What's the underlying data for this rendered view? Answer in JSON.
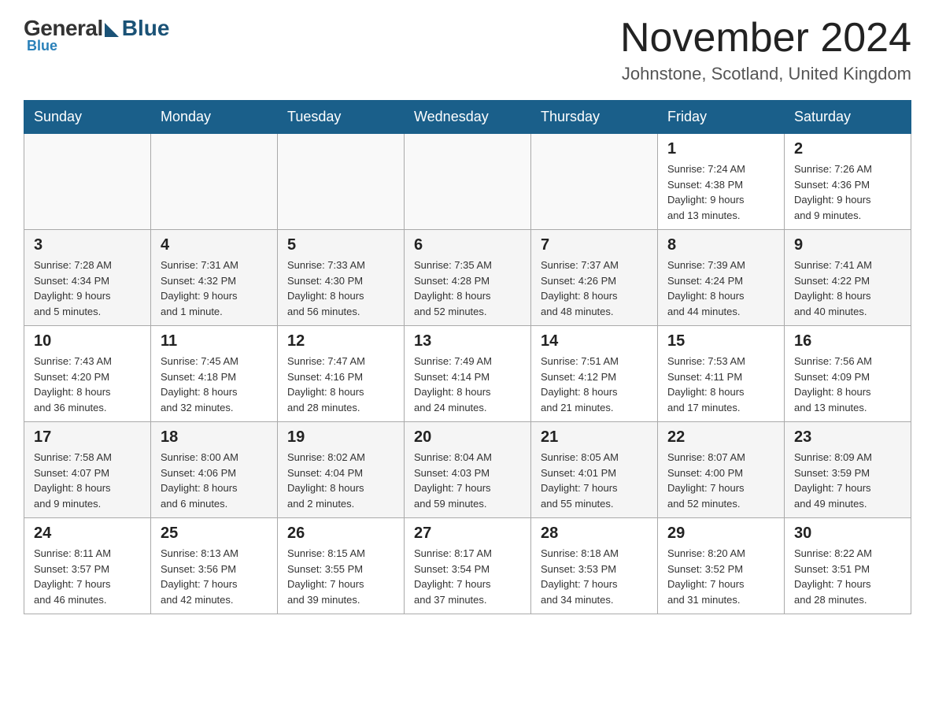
{
  "header": {
    "logo_general": "General",
    "logo_blue": "Blue",
    "month_title": "November 2024",
    "location": "Johnstone, Scotland, United Kingdom"
  },
  "weekdays": [
    "Sunday",
    "Monday",
    "Tuesday",
    "Wednesday",
    "Thursday",
    "Friday",
    "Saturday"
  ],
  "weeks": [
    [
      {
        "day": "",
        "info": ""
      },
      {
        "day": "",
        "info": ""
      },
      {
        "day": "",
        "info": ""
      },
      {
        "day": "",
        "info": ""
      },
      {
        "day": "",
        "info": ""
      },
      {
        "day": "1",
        "info": "Sunrise: 7:24 AM\nSunset: 4:38 PM\nDaylight: 9 hours\nand 13 minutes."
      },
      {
        "day": "2",
        "info": "Sunrise: 7:26 AM\nSunset: 4:36 PM\nDaylight: 9 hours\nand 9 minutes."
      }
    ],
    [
      {
        "day": "3",
        "info": "Sunrise: 7:28 AM\nSunset: 4:34 PM\nDaylight: 9 hours\nand 5 minutes."
      },
      {
        "day": "4",
        "info": "Sunrise: 7:31 AM\nSunset: 4:32 PM\nDaylight: 9 hours\nand 1 minute."
      },
      {
        "day": "5",
        "info": "Sunrise: 7:33 AM\nSunset: 4:30 PM\nDaylight: 8 hours\nand 56 minutes."
      },
      {
        "day": "6",
        "info": "Sunrise: 7:35 AM\nSunset: 4:28 PM\nDaylight: 8 hours\nand 52 minutes."
      },
      {
        "day": "7",
        "info": "Sunrise: 7:37 AM\nSunset: 4:26 PM\nDaylight: 8 hours\nand 48 minutes."
      },
      {
        "day": "8",
        "info": "Sunrise: 7:39 AM\nSunset: 4:24 PM\nDaylight: 8 hours\nand 44 minutes."
      },
      {
        "day": "9",
        "info": "Sunrise: 7:41 AM\nSunset: 4:22 PM\nDaylight: 8 hours\nand 40 minutes."
      }
    ],
    [
      {
        "day": "10",
        "info": "Sunrise: 7:43 AM\nSunset: 4:20 PM\nDaylight: 8 hours\nand 36 minutes."
      },
      {
        "day": "11",
        "info": "Sunrise: 7:45 AM\nSunset: 4:18 PM\nDaylight: 8 hours\nand 32 minutes."
      },
      {
        "day": "12",
        "info": "Sunrise: 7:47 AM\nSunset: 4:16 PM\nDaylight: 8 hours\nand 28 minutes."
      },
      {
        "day": "13",
        "info": "Sunrise: 7:49 AM\nSunset: 4:14 PM\nDaylight: 8 hours\nand 24 minutes."
      },
      {
        "day": "14",
        "info": "Sunrise: 7:51 AM\nSunset: 4:12 PM\nDaylight: 8 hours\nand 21 minutes."
      },
      {
        "day": "15",
        "info": "Sunrise: 7:53 AM\nSunset: 4:11 PM\nDaylight: 8 hours\nand 17 minutes."
      },
      {
        "day": "16",
        "info": "Sunrise: 7:56 AM\nSunset: 4:09 PM\nDaylight: 8 hours\nand 13 minutes."
      }
    ],
    [
      {
        "day": "17",
        "info": "Sunrise: 7:58 AM\nSunset: 4:07 PM\nDaylight: 8 hours\nand 9 minutes."
      },
      {
        "day": "18",
        "info": "Sunrise: 8:00 AM\nSunset: 4:06 PM\nDaylight: 8 hours\nand 6 minutes."
      },
      {
        "day": "19",
        "info": "Sunrise: 8:02 AM\nSunset: 4:04 PM\nDaylight: 8 hours\nand 2 minutes."
      },
      {
        "day": "20",
        "info": "Sunrise: 8:04 AM\nSunset: 4:03 PM\nDaylight: 7 hours\nand 59 minutes."
      },
      {
        "day": "21",
        "info": "Sunrise: 8:05 AM\nSunset: 4:01 PM\nDaylight: 7 hours\nand 55 minutes."
      },
      {
        "day": "22",
        "info": "Sunrise: 8:07 AM\nSunset: 4:00 PM\nDaylight: 7 hours\nand 52 minutes."
      },
      {
        "day": "23",
        "info": "Sunrise: 8:09 AM\nSunset: 3:59 PM\nDaylight: 7 hours\nand 49 minutes."
      }
    ],
    [
      {
        "day": "24",
        "info": "Sunrise: 8:11 AM\nSunset: 3:57 PM\nDaylight: 7 hours\nand 46 minutes."
      },
      {
        "day": "25",
        "info": "Sunrise: 8:13 AM\nSunset: 3:56 PM\nDaylight: 7 hours\nand 42 minutes."
      },
      {
        "day": "26",
        "info": "Sunrise: 8:15 AM\nSunset: 3:55 PM\nDaylight: 7 hours\nand 39 minutes."
      },
      {
        "day": "27",
        "info": "Sunrise: 8:17 AM\nSunset: 3:54 PM\nDaylight: 7 hours\nand 37 minutes."
      },
      {
        "day": "28",
        "info": "Sunrise: 8:18 AM\nSunset: 3:53 PM\nDaylight: 7 hours\nand 34 minutes."
      },
      {
        "day": "29",
        "info": "Sunrise: 8:20 AM\nSunset: 3:52 PM\nDaylight: 7 hours\nand 31 minutes."
      },
      {
        "day": "30",
        "info": "Sunrise: 8:22 AM\nSunset: 3:51 PM\nDaylight: 7 hours\nand 28 minutes."
      }
    ]
  ]
}
